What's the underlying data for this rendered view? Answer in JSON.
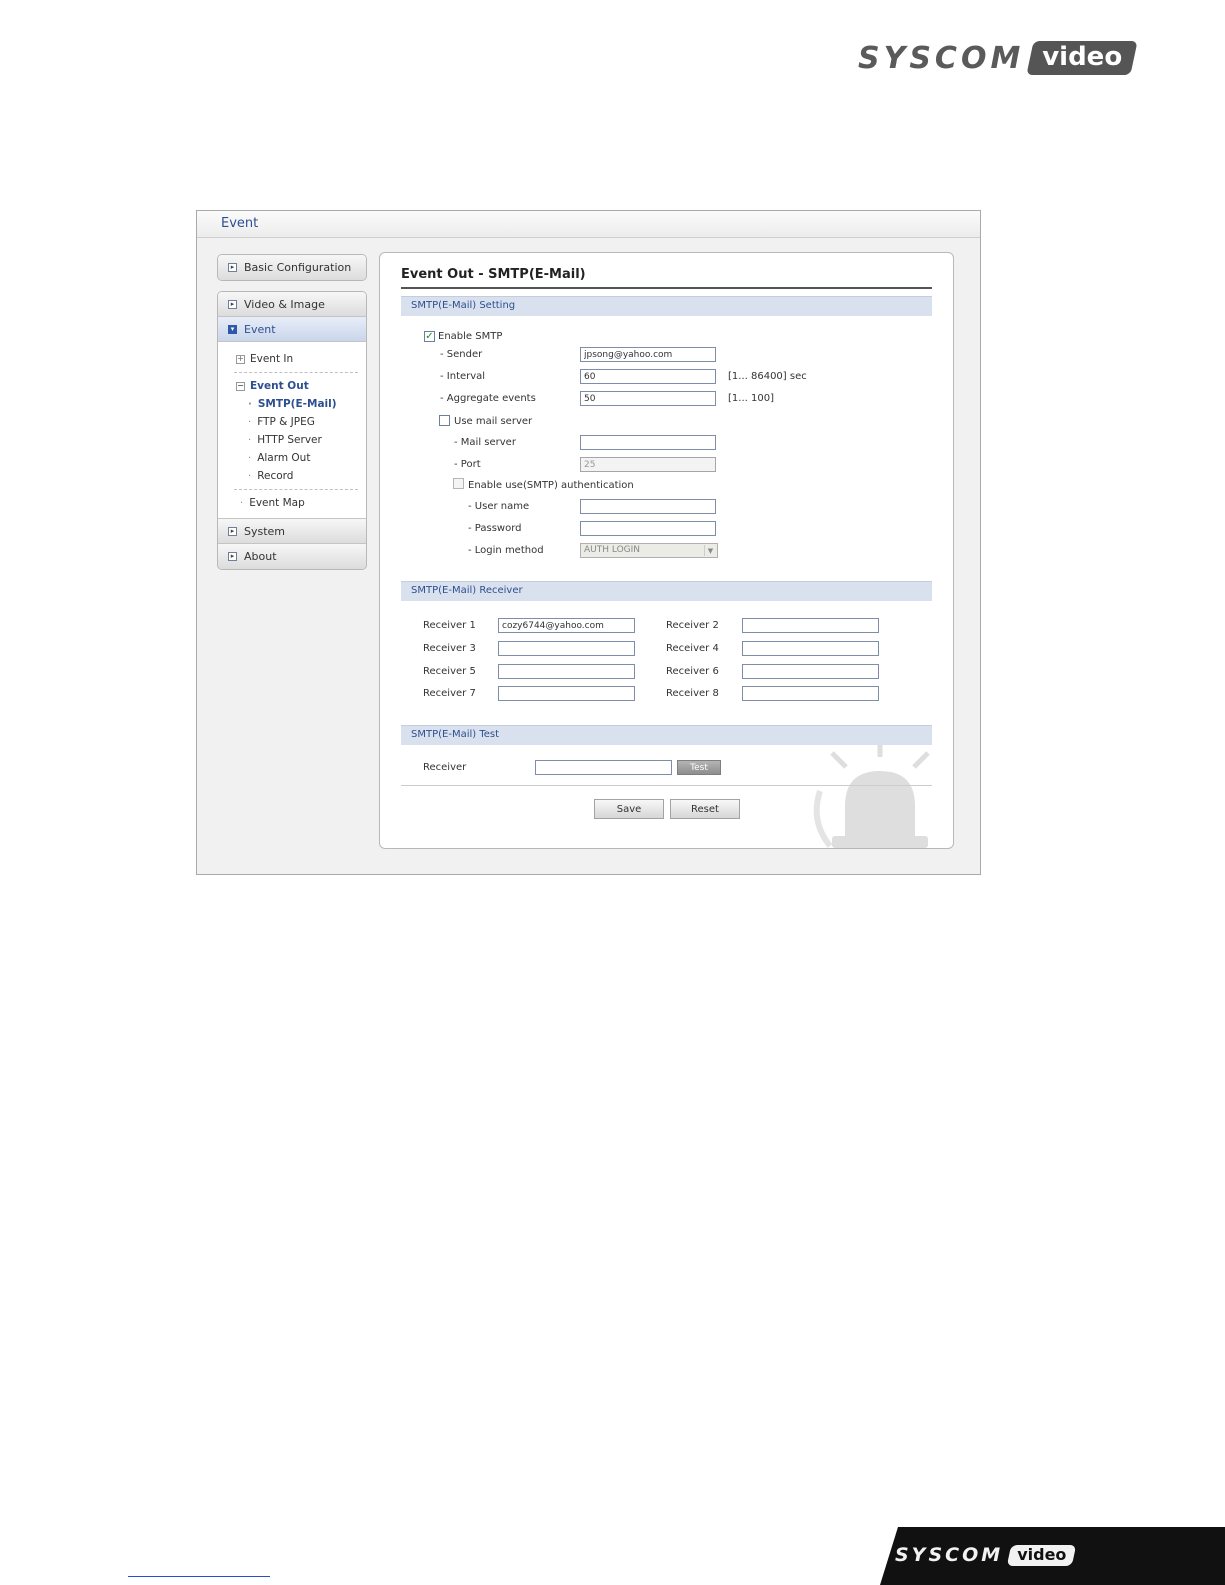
{
  "brand": {
    "name": "SYSCOM",
    "suffix": "video"
  },
  "window": {
    "title": "Event"
  },
  "sidebar": {
    "basic_configuration": "Basic Configuration",
    "video_image": "Video & Image",
    "event": "Event",
    "event_in": "Event In",
    "event_out": "Event Out",
    "event_out_items": [
      "SMTP(E-Mail)",
      "FTP & JPEG",
      "HTTP Server",
      "Alarm Out",
      "Record"
    ],
    "event_map": "Event Map",
    "system": "System",
    "about": "About"
  },
  "page": {
    "title": "Event Out - SMTP(E-Mail)",
    "setting": {
      "section": "SMTP(E-Mail) Setting",
      "enable_smtp": "Enable SMTP",
      "enable_smtp_checked": true,
      "sender_label": "- Sender",
      "sender_value": "jpsong@yahoo.com",
      "interval_label": "- Interval",
      "interval_value": "60",
      "interval_hint": "[1... 86400] sec",
      "aggregate_label": "- Aggregate events",
      "aggregate_value": "50",
      "aggregate_hint": "[1... 100]",
      "use_mail_server": "Use mail server",
      "mail_server_label": "- Mail server",
      "mail_server_value": "",
      "port_label": "- Port",
      "port_value": "25",
      "enable_auth": "Enable use(SMTP) authentication",
      "user_name_label": "- User name",
      "password_label": "- Password",
      "login_method_label": "- Login method",
      "login_method_value": "AUTH LOGIN"
    },
    "receiver": {
      "section": "SMTP(E-Mail) Receiver",
      "labels": [
        "Receiver 1",
        "Receiver 2",
        "Receiver 3",
        "Receiver 4",
        "Receiver 5",
        "Receiver 6",
        "Receiver 7",
        "Receiver 8"
      ],
      "values": [
        "cozy6744@yahoo.com",
        "",
        "",
        "",
        "",
        "",
        "",
        ""
      ]
    },
    "test": {
      "section": "SMTP(E-Mail) Test",
      "receiver_label": "Receiver",
      "receiver_value": "",
      "test_button": "Test"
    },
    "actions": {
      "save": "Save",
      "reset": "Reset"
    }
  }
}
